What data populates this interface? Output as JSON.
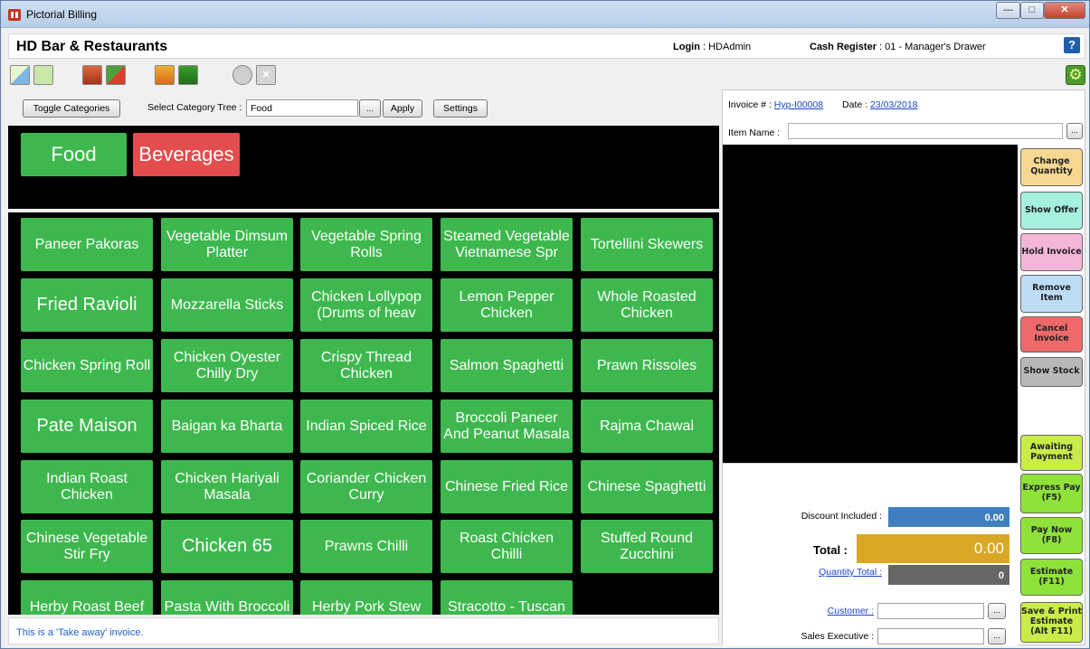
{
  "window": {
    "title": "Pictorial Billing"
  },
  "header": {
    "company": "HD Bar & Restaurants",
    "login_label": "Login",
    "login_value": "HDAdmin",
    "register_label": "Cash Register",
    "register_value": "01 - Manager's Drawer",
    "help_label": "?"
  },
  "category_bar": {
    "toggle_label": "Toggle Categories",
    "tree_label": "Select Category Tree :",
    "tree_value": "Food",
    "browse_label": "...",
    "apply_label": "Apply",
    "settings_label": "Settings"
  },
  "categories": [
    {
      "label": "Food",
      "color": "#3eb84e"
    },
    {
      "label": "Beverages",
      "color": "#e34d4d"
    }
  ],
  "items": [
    "Paneer Pakoras",
    "Vegetable Dimsum Platter",
    "Vegetable Spring Rolls",
    "Steamed Vegetable Vietnamese Spr",
    "Tortellini Skewers",
    "Fried Ravioli",
    "Mozzarella Sticks",
    "Chicken Lollypop (Drums of heav",
    "Lemon Pepper Chicken",
    "Whole Roasted Chicken",
    "Chicken Spring Roll",
    "Chicken Oyester Chilly Dry",
    "Crispy Thread Chicken",
    "Salmon Spaghetti",
    "Prawn Rissoles",
    "Pate Maison",
    "Baigan ka Bharta",
    "Indian Spiced Rice",
    "Broccoli Paneer And Peanut Masala",
    "Rajma Chawal",
    "Indian Roast Chicken",
    "Chicken Hariyali Masala",
    "Coriander Chicken Curry",
    "Chinese Fried Rice",
    "Chinese Spaghetti",
    "Chinese Vegetable Stir Fry",
    "Chicken 65",
    "Prawns Chilli",
    "Roast Chicken Chilli",
    "Stuffed Round Zucchini",
    "Herby Roast Beef",
    "Pasta With Broccoli",
    "Herby Pork Stew",
    "Stracotto - Tuscan"
  ],
  "status": {
    "text": "This is a 'Take away' invoice."
  },
  "invoice": {
    "number_label": "Invoice # :",
    "number_value": "Hyp-I00008",
    "date_label": "Date :",
    "date_value": "23/03/2018",
    "item_name_label": "Item Name :",
    "browse_label": "..."
  },
  "totals": {
    "discount_label": "Discount Included :",
    "discount_value": "0.00",
    "total_label": "Total :",
    "total_value": "0.00",
    "qty_label": "Quantity Total :",
    "qty_value": "0",
    "customer_label": "Customer :",
    "executive_label": "Sales Executive :",
    "browse_label": "..."
  },
  "actions": {
    "change_quantity": "Change Quantity",
    "show_offer": "Show Offer",
    "hold_invoice": "Hold Invoice",
    "remove_item": "Remove Item",
    "cancel_invoice": "Cancel Invoice",
    "show_stock": "Show Stock",
    "awaiting_payment": "Awaiting Payment",
    "express_pay": "Express Pay (F5)",
    "pay_now": "Pay Now (F8)",
    "estimate": "Estimate (F11)",
    "save_print_estimate": "Save & Print Estimate (Alt F11)"
  },
  "colors": {
    "item_green": "#3eb84e",
    "discount_blue": "#3f7fc0",
    "total_gold": "#dba826",
    "qty_gray": "#666666"
  }
}
